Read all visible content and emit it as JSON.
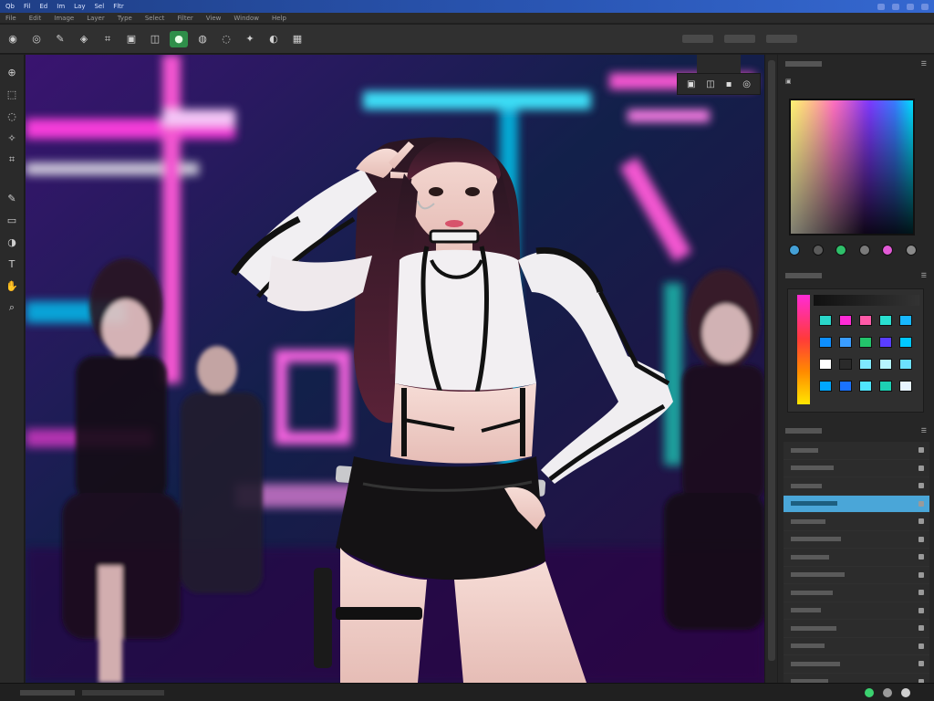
{
  "titlebar": {
    "menus": [
      "Qb",
      "Fil",
      "Ed",
      "Im",
      "Lay",
      "Sel",
      "Fltr"
    ],
    "icons": [
      "window-icon",
      "cloud-icon",
      "minimize-icon",
      "maximize-icon"
    ]
  },
  "menubar": [
    "File",
    "Edit",
    "Image",
    "Layer",
    "Type",
    "Select",
    "Filter",
    "View",
    "Window",
    "Help"
  ],
  "toolbar": {
    "tools": [
      {
        "icon": "camera-icon",
        "glyph": "◉"
      },
      {
        "icon": "eye-icon",
        "glyph": "◎"
      },
      {
        "icon": "brush-icon",
        "glyph": "✎"
      },
      {
        "icon": "paint-bucket-icon",
        "glyph": "◈"
      },
      {
        "icon": "crop-icon",
        "glyph": "⌗"
      },
      {
        "icon": "image-icon",
        "glyph": "▣"
      },
      {
        "icon": "layers-icon",
        "glyph": "◫"
      },
      {
        "icon": "color-picker-icon",
        "glyph": "●",
        "active": true
      },
      {
        "icon": "stamp-icon",
        "glyph": "◍"
      },
      {
        "icon": "eraser-icon",
        "glyph": "◌"
      },
      {
        "icon": "blur-icon",
        "glyph": "✦"
      },
      {
        "icon": "dodge-icon",
        "glyph": "◐"
      },
      {
        "icon": "sponge-icon",
        "glyph": "▦"
      }
    ]
  },
  "lefttools": [
    {
      "icon": "move-icon",
      "glyph": "⊕"
    },
    {
      "icon": "marquee-icon",
      "glyph": "⬚"
    },
    {
      "icon": "lasso-icon",
      "glyph": "◌"
    },
    {
      "icon": "wand-icon",
      "glyph": "✧"
    },
    {
      "icon": "crop-tool-icon",
      "glyph": "⌗"
    },
    {
      "icon": "brush-tool-icon",
      "glyph": "✎",
      "sep": true
    },
    {
      "icon": "eraser-tool-icon",
      "glyph": "▭"
    },
    {
      "icon": "gradient-tool-icon",
      "glyph": "◑"
    },
    {
      "icon": "text-tool-icon",
      "glyph": "T"
    },
    {
      "icon": "hand-tool-icon",
      "glyph": "✋"
    },
    {
      "icon": "zoom-tool-icon",
      "glyph": "⌕"
    }
  ],
  "canvas": {
    "float_tools": [
      "image-icon",
      "adjust-icon",
      "comment-icon",
      "settings-icon"
    ]
  },
  "colors": {
    "accent": "#4aa6d8",
    "active_tool": "#2f8f4a",
    "panel_bg": "#262626"
  },
  "rpanel": {
    "color_dots": [
      "#44a0d6",
      "#5a5a5a",
      "#2fbf6a",
      "#7a7a7a",
      "#e25ad6",
      "#8a8a8a"
    ],
    "swatches": [
      {
        "c": "#2ad6c9"
      },
      {
        "c": "#ff2bd6"
      },
      {
        "c": "#ff5aa8"
      },
      {
        "c": "#29e0d0"
      },
      {
        "c": "#18b8ff"
      },
      {
        "c": "#0e8fff"
      },
      {
        "c": "#3a9dff"
      },
      {
        "c": "#23c46b"
      },
      {
        "c": "#5a3dff"
      },
      {
        "c": "#00c8ff"
      },
      {
        "c": "#ffffff"
      },
      {
        "c": "#2a2a2a"
      },
      {
        "c": "#7fe9ff"
      },
      {
        "c": "#b7f5ff"
      },
      {
        "c": "#6ce0ff"
      },
      {
        "c": "#00a7ff"
      },
      {
        "c": "#1a73ff"
      },
      {
        "c": "#50e6ff"
      },
      {
        "c": "#1dd1b3"
      },
      {
        "c": "#e8f4ff"
      }
    ],
    "layer_count": 14,
    "selected_layer": 3
  }
}
